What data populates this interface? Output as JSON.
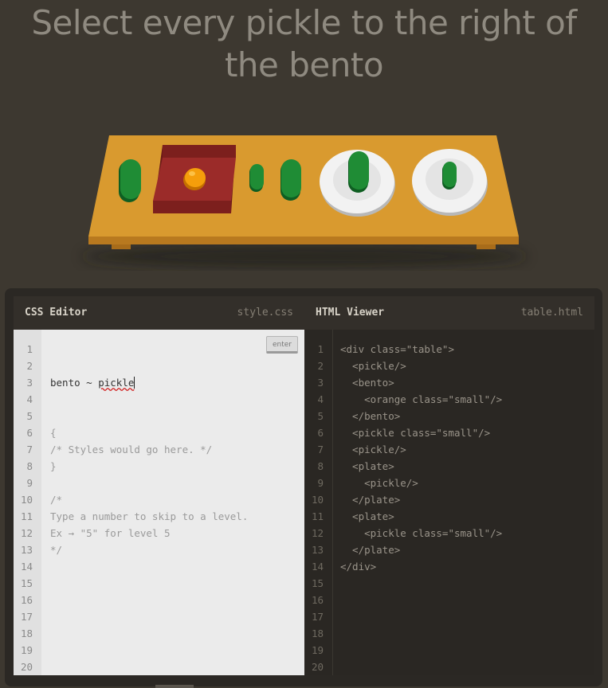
{
  "instruction": "Select every pickle to the right of the bento",
  "css_editor": {
    "title": "CSS Editor",
    "filename": "style.css",
    "line_numbers": [
      "1",
      "2",
      "3",
      "4",
      "5",
      "6",
      "7",
      "8",
      "9",
      "10",
      "11",
      "12",
      "13",
      "14",
      "15",
      "16",
      "17",
      "18",
      "19",
      "20"
    ],
    "input_prefix": "bento ~ ",
    "input_word": "pickle",
    "code_lines": [
      "{",
      "/* Styles would go here. */",
      "}",
      "",
      "/*",
      "Type a number to skip to a level.",
      "Ex → \"5\" for level 5",
      "*/"
    ],
    "enter_label": "enter"
  },
  "html_viewer": {
    "title": "HTML Viewer",
    "filename": "table.html",
    "line_numbers": [
      "1",
      "2",
      "3",
      "4",
      "5",
      "6",
      "7",
      "8",
      "9",
      "10",
      "11",
      "12",
      "13",
      "14",
      "15",
      "16",
      "17",
      "18",
      "19",
      "20"
    ],
    "code_lines": [
      "<div class=\"table\">",
      "  <pickle/>",
      "  <bento>",
      "    <orange class=\"small\"/>",
      "  </bento>",
      "  <pickle class=\"small\"/>",
      "  <pickle/>",
      "  <plate>",
      "    <pickle/>",
      "  </plate>",
      "  <plate>",
      "    <pickle class=\"small\"/>",
      "  </plate>",
      "</div>"
    ]
  },
  "colors": {
    "background": "#3d3830",
    "table": "#d99a2f",
    "bento": "#9b2b29",
    "pickle": "#1f8c35",
    "orange": "#f59e0b",
    "plate": "#f2f2f2"
  }
}
